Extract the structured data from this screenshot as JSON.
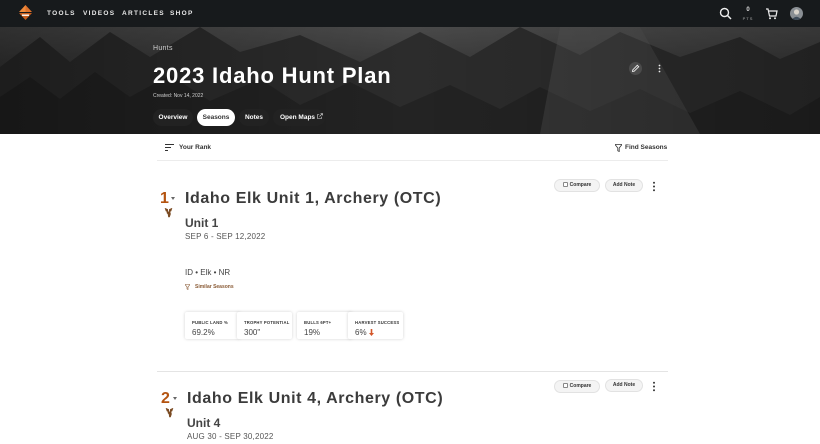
{
  "nav": {
    "links": [
      "TOOLS",
      "VIDEOS",
      "ARTICLES",
      "SHOP"
    ],
    "points_value": "0",
    "points_label": "PTS"
  },
  "hero": {
    "breadcrumb": "Hunts",
    "title": "2023 Idaho Hunt Plan",
    "created": "Created: Nov 14, 2022",
    "tabs": [
      "Overview",
      "Seasons",
      "Notes",
      "Open Maps"
    ],
    "active_tab": "Seasons"
  },
  "toolbar": {
    "rank_label": "Your Rank",
    "find_label": "Find Seasons"
  },
  "cards": [
    {
      "rank": "1",
      "title": "Idaho Elk Unit 1, Archery (OTC)",
      "unit": "Unit 1",
      "dates": "SEP 6 - SEP 12,2022",
      "compare_label": "Compare",
      "note_label": "Add Note",
      "tags": "ID • Elk • NR",
      "similar_label": "Similar Seasons",
      "stats": [
        {
          "label": "PUBLIC LAND %",
          "value": "69.2%"
        },
        {
          "label": "TROPHY POTENTIAL",
          "value": "300\""
        },
        {
          "label": "BULLS 6PT+",
          "value": "19%"
        },
        {
          "label": "HARVEST SUCCESS",
          "value": "6%"
        }
      ]
    },
    {
      "rank": "2",
      "title": "Idaho Elk Unit 4, Archery (OTC)",
      "unit": "Unit 4",
      "dates": "AUG 30 - SEP 30,2022",
      "compare_label": "Compare",
      "note_label": "Add Note"
    }
  ],
  "colors": {
    "accent": "#b4530f",
    "nav_bg": "#171a1c",
    "logo_orange": "#e0722b",
    "trend_down": "#d4572a"
  },
  "icons": [
    "logo-icon",
    "search-icon",
    "cart-icon",
    "edit-icon",
    "more-icon",
    "sort-icon",
    "filter-icon",
    "elk-icon",
    "external-link-icon",
    "arrow-down-icon"
  ]
}
